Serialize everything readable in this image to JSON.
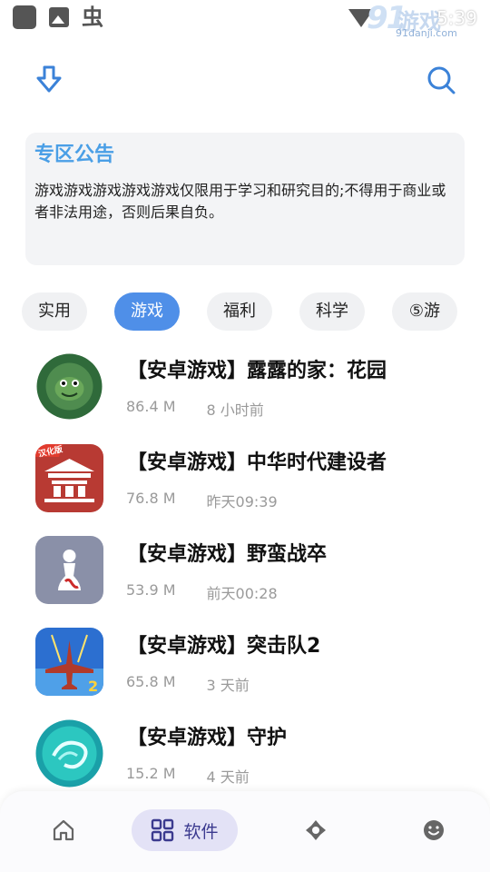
{
  "status_bar": {
    "time": "5:39",
    "watermark_brand": "91",
    "watermark_text": "游戏",
    "watermark_domain": "91danji.com"
  },
  "toolbar": {
    "download_icon": "download-arrow-icon",
    "search_icon": "search-icon"
  },
  "notice": {
    "title": "专区公告",
    "body": "游戏游戏游戏游戏游戏仅限用于学习和研究目的;不得用于商业或者非法用途，否则后果自负。"
  },
  "categories": [
    {
      "label": "实用",
      "active": false
    },
    {
      "label": "游戏",
      "active": true
    },
    {
      "label": "福利",
      "active": false
    },
    {
      "label": "科学",
      "active": false
    },
    {
      "label": "⑤游",
      "active": false
    }
  ],
  "apps": [
    {
      "name": "【安卓游戏】露露的家：花园",
      "size": "86.4 M",
      "time": "8 小时前"
    },
    {
      "name": "【安卓游戏】中华时代建设者",
      "size": "76.8 M",
      "time": "昨天09:39",
      "badge": "汉化版"
    },
    {
      "name": "【安卓游戏】野蛮战卒",
      "size": "53.9 M",
      "time": "前天00:28"
    },
    {
      "name": "【安卓游戏】突击队2",
      "size": "65.8 M",
      "time": "3 天前"
    },
    {
      "name": "【安卓游戏】守护",
      "size": "15.2 M",
      "time": "4 天前"
    }
  ],
  "bottom_nav": {
    "home_icon": "home-icon",
    "software_label": "软件",
    "software_icon": "grid-icon",
    "explore_icon": "compass-icon",
    "me_icon": "smiley-icon"
  },
  "colors": {
    "accent": "#4f8fe8",
    "notice_title": "#4a9fe6",
    "nav_active_bg": "#e3e2f6",
    "nav_active_fg": "#3b3a8f"
  }
}
